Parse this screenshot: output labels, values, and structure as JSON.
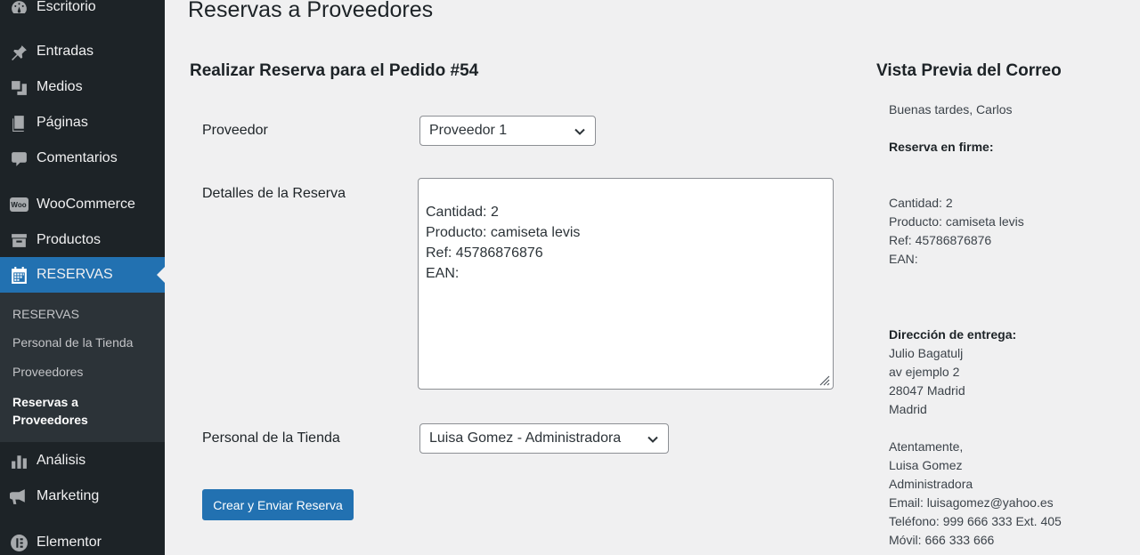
{
  "sidebar": {
    "items": [
      {
        "label": "Escritorio",
        "icon": "dashboard-icon"
      },
      {
        "label": "Entradas",
        "icon": "pin-icon"
      },
      {
        "label": "Medios",
        "icon": "media-icon"
      },
      {
        "label": "Páginas",
        "icon": "pages-icon"
      },
      {
        "label": "Comentarios",
        "icon": "comment-icon"
      },
      {
        "label": "WooCommerce",
        "icon": "woocommerce-icon",
        "badge": "Woo"
      },
      {
        "label": "Productos",
        "icon": "archive-icon"
      },
      {
        "label": "RESERVAS",
        "icon": "calendar-icon"
      },
      {
        "label": "Análisis",
        "icon": "bar-chart-icon"
      },
      {
        "label": "Marketing",
        "icon": "megaphone-icon"
      },
      {
        "label": "Elementor",
        "icon": "elementor-icon"
      }
    ],
    "submenu": [
      "RESERVAS",
      "Personal de la Tienda",
      "Proveedores",
      "Reservas a\nProveedores"
    ]
  },
  "page": {
    "title": "Reservas a Proveedores"
  },
  "form": {
    "title": "Realizar Reserva para el Pedido #54",
    "provider_label": "Proveedor",
    "provider_value": "Proveedor 1",
    "details_label": "Detalles de la Reserva",
    "details_value": "Cantidad: 2\nProducto: camiseta levis\nRef: 45786876876\nEAN:",
    "staff_label": "Personal de la Tienda",
    "staff_value": "Luisa Gomez - Administradora",
    "submit_label": "Crear y Enviar Reserva"
  },
  "preview": {
    "title": "Vista Previa del Correo",
    "greeting": "Buenas tardes, Carlos",
    "firm_heading": "Reserva en firme:",
    "lines": [
      "Cantidad: 2",
      "Producto: camiseta levis",
      "Ref: 45786876876",
      "EAN:"
    ],
    "address_heading": "Dirección de entrega:",
    "address": [
      "Julio Bagatulj",
      "av ejemplo 2",
      "28047 Madrid",
      "Madrid"
    ],
    "closing": [
      "Atentamente,",
      "Luisa Gomez",
      "Administradora",
      "Email: luisagomez@yahoo.es",
      "Teléfono: 999 666 333 Ext. 405",
      "Móvil: 666 333 666"
    ]
  },
  "colors": {
    "sidebar_bg": "#1d2327",
    "submenu_bg": "#2c3338",
    "accent": "#2271b1",
    "page_bg": "#f0f0f1"
  }
}
